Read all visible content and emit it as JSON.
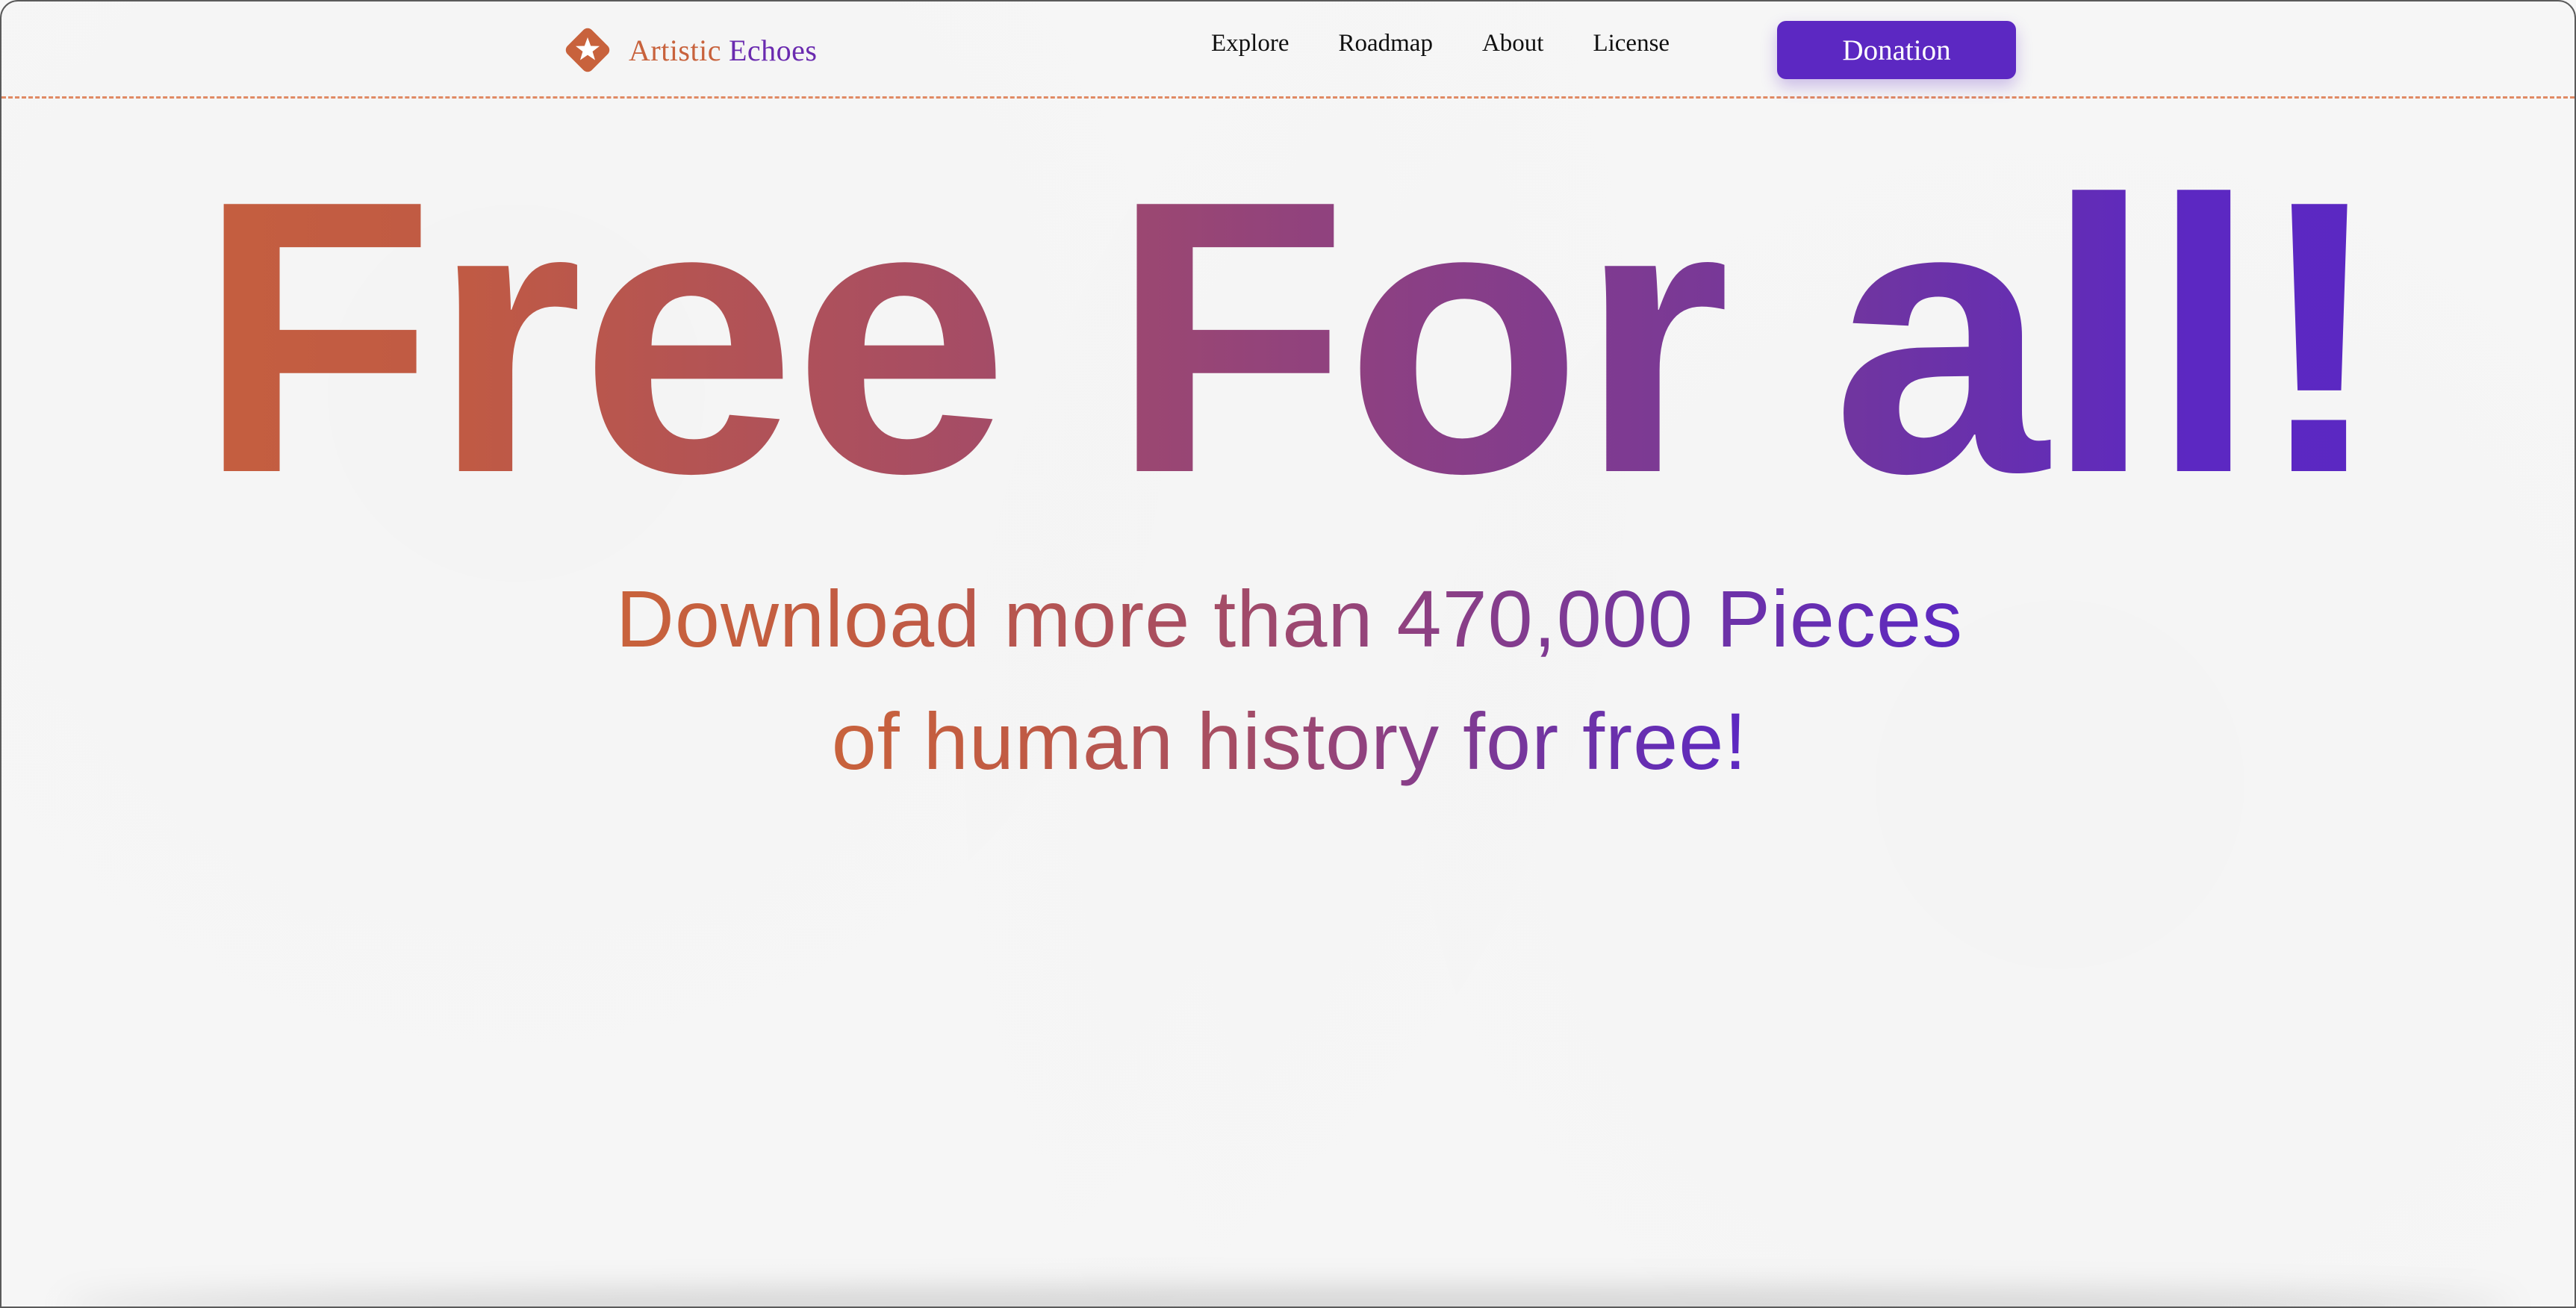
{
  "brand": {
    "name_part1": "Artistic",
    "name_part2": "Echoes",
    "logo_icon": "diamond-star-icon",
    "colors": {
      "primary": "#c8623c",
      "secondary": "#6a2aaf"
    }
  },
  "nav": {
    "items": [
      {
        "label": "Explore"
      },
      {
        "label": "Roadmap"
      },
      {
        "label": "About"
      },
      {
        "label": "License"
      }
    ],
    "donate_label": "Donation",
    "donate_color": "#5c28c2"
  },
  "hero": {
    "title": "Free For all!",
    "subtitle_line1": "Download more than 470,000 Pieces",
    "subtitle_line2": "of human history for free!",
    "gradient": [
      "#c8623c",
      "#5c28c2"
    ]
  }
}
